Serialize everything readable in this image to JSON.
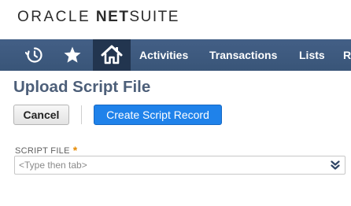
{
  "brand": {
    "oracle": "ORACLE",
    "net": "NET",
    "suite": "SUITE"
  },
  "nav": {
    "icons": [
      "recent-history-icon",
      "star-icon",
      "home-icon"
    ],
    "items": [
      {
        "label": "Activities"
      },
      {
        "label": "Transactions"
      },
      {
        "label": "Lists"
      },
      {
        "label": "R"
      }
    ]
  },
  "page": {
    "title": "Upload Script File",
    "cancel_label": "Cancel",
    "create_label": "Create Script Record"
  },
  "form": {
    "script_file": {
      "label": "SCRIPT FILE",
      "required_mark": "*",
      "placeholder": "<Type then tab>",
      "value": "",
      "dropdown_icon": "double-chevron-down-icon"
    }
  },
  "colors": {
    "nav_bg": "#3d5a80",
    "nav_active": "#22354f",
    "title": "#4d5f79",
    "primary_button": "#1f82ea",
    "required": "#e68a00"
  }
}
